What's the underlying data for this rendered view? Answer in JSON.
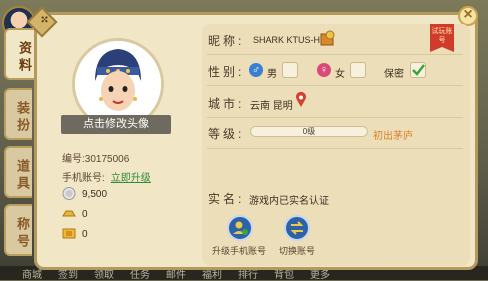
{
  "tabs": [
    {
      "label": "资料"
    },
    {
      "label": "装扮"
    },
    {
      "label": "道具"
    },
    {
      "label": "称号"
    }
  ],
  "profile": {
    "change_avatar": "点击修改头像",
    "id_label": "编号:",
    "id_value": "30175006",
    "phone_label": "手机账号:",
    "phone_link": "立即升级",
    "silver_coins": "9,500",
    "gold_count": "0",
    "ticket_count": "0"
  },
  "details": {
    "nickname_label": "昵称:",
    "nickname_value": "SHARK KTUS-H",
    "gender_label": "性别:",
    "male": "男",
    "female": "女",
    "secret": "保密",
    "city_label": "城市:",
    "city_value": "云南 昆明",
    "level_label": "等级:",
    "level_value": "0级",
    "level_rank": "初出茅庐",
    "realname_label": "实名:",
    "realname_value": "游戏内已实名认证",
    "trial_badge": "试玩账号"
  },
  "actions": {
    "upgrade": "升级手机账号",
    "switch": "切换账号"
  },
  "bottom_menu": [
    "商城",
    "签到",
    "领取",
    "任务",
    "邮件",
    "福利",
    "排行",
    "背包",
    "更多"
  ],
  "colors": {
    "panel_bg": "#f1e6c5",
    "border": "#b39a5c",
    "accent_orange": "#e0802a",
    "link_green": "#2f8b3d",
    "check_green": "#3aa63a"
  }
}
